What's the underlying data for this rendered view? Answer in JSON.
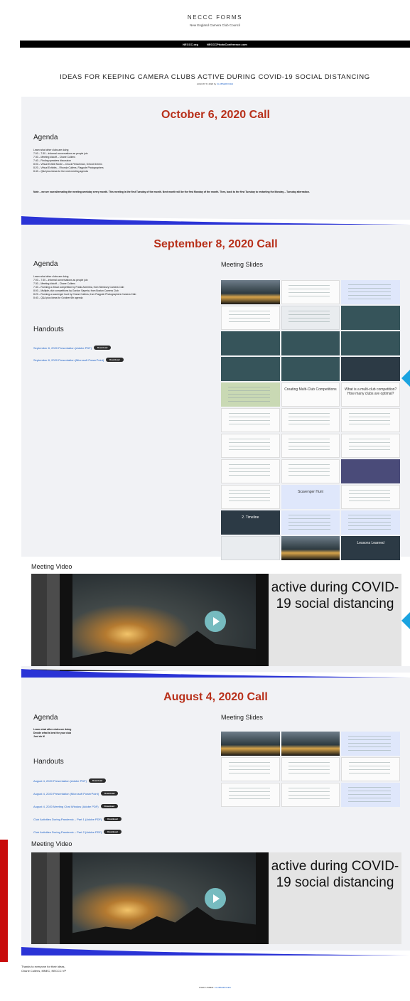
{
  "site": {
    "title": "NECCC FORMS",
    "subtitle": "New England Camera Club Council",
    "nav": [
      "NECCC.org",
      "NECCCPhotoConference.com"
    ]
  },
  "page": {
    "title": "IDEAS FOR KEEPING CAMERA CLUBS ACTIVE DURING COVID-19 SOCIAL DISTANCING",
    "meta_prefix": "AUGUST 8, 2020 by",
    "meta_link": "CLUBSERVICES"
  },
  "oct": {
    "title": "October 6, 2020 Call",
    "agenda_heading": "Agenda",
    "agenda": [
      "Learn what other clubs are doing",
      "7:00 – 7:30 – informal conversations as people join",
      "7:30 – Meeting kickoff – Chane Cullens",
      "7:40 – Finding speakers discussion",
      "8:00 – Virtual Exhibit Movie – Chuck Fleischman, Oxford Greens",
      "8:20 – Virtual Exhibits – Rhonda Cullens, Flagpole Photographers",
      "8:40 – Q&A plus ideas for the next meeting agenda"
    ],
    "note": "Note – we are now alternating the meeting weekday every month. This meeting is the first Tuesday of the month. Next month will be the first Monday of the month. Then, back to the first Tuesday to restarting the Monday – Tuesday alternation."
  },
  "sep": {
    "title": "September 8, 2020 Call",
    "agenda_heading": "Agenda",
    "agenda": [
      "Learn what other clubs are doing",
      "7:00 – 7:30 – informal conversations as people join",
      "7:30 – Meeting kickoff – Chane Cullens",
      "7:40 – Running a virtual competition by Frank Zaremba, from Simsbury Camera Club",
      "8:00 – Multiple-club competitions by Gordon Saperia, from Boston Camera Club",
      "8:20 – Running a scavenger hunt by Chane Cullens, from Flagpole Photographers Camera Club",
      "8:40 – Q&A plus ideas for October 6th agenda"
    ],
    "handouts_heading": "Handouts",
    "handouts": [
      "September 8, 2020 Presentation (Adobe PDF)",
      "September 8, 2020 Presentation (Microsoft PowerPoint)"
    ],
    "download_label": "Download",
    "slides_heading": "Meeting Slides",
    "slide_captions": {
      "multi": "Creating Multi-Club Competitions",
      "multi2": "What is a multi-club competition? How many clubs are optimal?",
      "scav": "Scavenger Hunt",
      "timeline": "2. Timeline",
      "lessons": "Lessons Learned"
    },
    "video_heading": "Meeting Video",
    "video_text": "active during COVID-19 social distancing"
  },
  "aug": {
    "title": "August 4, 2020 Call",
    "agenda_heading": "Agenda",
    "agenda": [
      "Learn what other clubs are doing",
      "Decide what is best for your club",
      "Just do it!"
    ],
    "handouts_heading": "Handouts",
    "handouts": [
      "August 4, 2020 Presentation (Adobe PDF)",
      "August 4, 2020 Presentation (Microsoft PowerPoint)",
      "August 4, 2020 Meeting Chat Window (Adobe PDF)",
      "Club Activities During Pandemic – Part 1 (Adobe PDF)",
      "Club Activities During Pandemic – Part 2 (Adobe PDF)"
    ],
    "download_label": "Download",
    "slides_heading": "Meeting Slides",
    "video_heading": "Meeting Video",
    "video_text": "active during COVID-19 social distancing"
  },
  "footer": {
    "thanks": "Thanks to everyone for their ideas,",
    "sign": "Chane Cullens, MNEC, NECCC VP",
    "filed_prefix": "FILED UNDER:",
    "filed_link": "CLUBSERVICES"
  },
  "colors": {
    "accent_red": "#b8301a",
    "link_blue": "#1e62c8",
    "swoosh_blue": "#2a33d6",
    "arrow_cyan": "#1aa3e0"
  }
}
